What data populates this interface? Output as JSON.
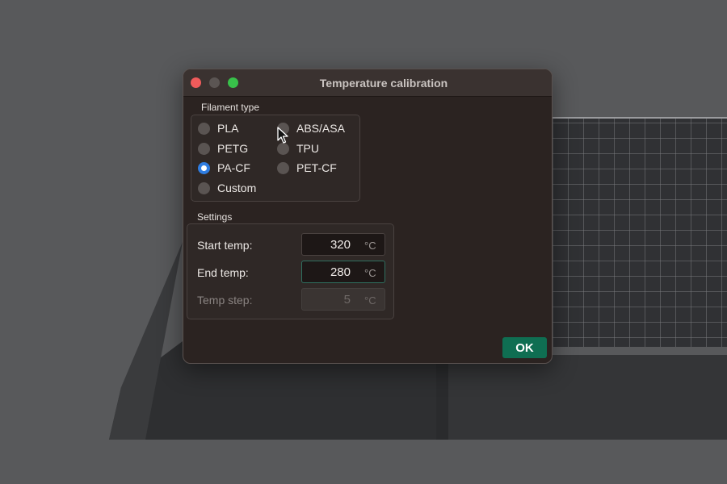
{
  "window": {
    "title": "Temperature calibration"
  },
  "filament": {
    "label": "Filament type",
    "options": [
      {
        "label": "PLA",
        "selected": false
      },
      {
        "label": "ABS/ASA",
        "selected": false
      },
      {
        "label": "PETG",
        "selected": false
      },
      {
        "label": "TPU",
        "selected": false
      },
      {
        "label": "PA-CF",
        "selected": true
      },
      {
        "label": "PET-CF",
        "selected": false
      },
      {
        "label": "Custom",
        "selected": false
      }
    ]
  },
  "settings": {
    "label": "Settings",
    "start_temp": {
      "label": "Start temp:",
      "value": "320",
      "unit": "°C"
    },
    "end_temp": {
      "label": "End temp:",
      "value": "280",
      "unit": "°C"
    },
    "temp_step": {
      "label": "Temp step:",
      "value": "5",
      "unit": "°C"
    }
  },
  "buttons": {
    "ok_label": "OK"
  },
  "colors": {
    "accent": "#2f7de1",
    "ok_button": "#0f6e52",
    "window_bg": "#2b2321"
  }
}
